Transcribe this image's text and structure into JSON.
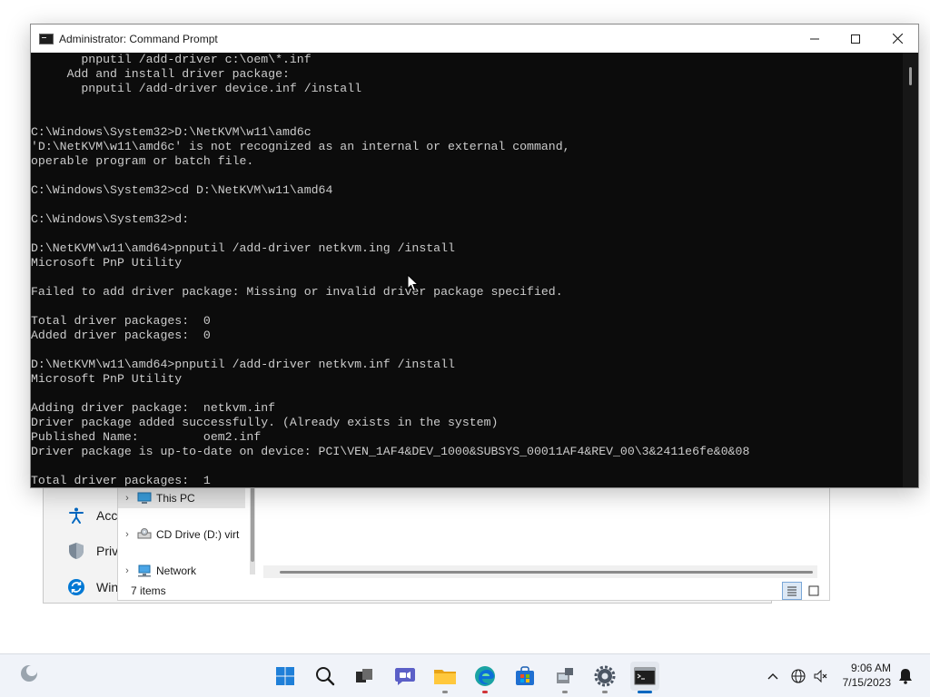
{
  "cmd": {
    "title": "Administrator: Command Prompt",
    "lines": [
      "       pnputil /add-driver c:\\oem\\*.inf",
      "     Add and install driver package:",
      "       pnputil /add-driver device.inf /install",
      "",
      "",
      "C:\\Windows\\System32>D:\\NetKVM\\w11\\amd6c",
      "'D:\\NetKVM\\w11\\amd6c' is not recognized as an internal or external command,",
      "operable program or batch file.",
      "",
      "C:\\Windows\\System32>cd D:\\NetKVM\\w11\\amd64",
      "",
      "C:\\Windows\\System32>d:",
      "",
      "D:\\NetKVM\\w11\\amd64>pnputil /add-driver netkvm.ing /install",
      "Microsoft PnP Utility",
      "",
      "Failed to add driver package: Missing or invalid driver package specified.",
      "",
      "Total driver packages:  0",
      "Added driver packages:  0",
      "",
      "D:\\NetKVM\\w11\\amd64>pnputil /add-driver netkvm.inf /install",
      "Microsoft PnP Utility",
      "",
      "Adding driver package:  netkvm.inf",
      "Driver package added successfully. (Already exists in the system)",
      "Published Name:         oem2.inf",
      "Driver package is up-to-date on device: PCI\\VEN_1AF4&DEV_1000&SUBSYS_00011AF4&REV_00\\3&2411e6fe&0&08",
      "",
      "Total driver packages:  1"
    ]
  },
  "settings": {
    "items": [
      {
        "label": "Acc",
        "icon": "accessibility-icon"
      },
      {
        "label": "Priv",
        "icon": "privacy-shield-icon"
      },
      {
        "label": "Win",
        "icon": "windows-update-icon"
      }
    ]
  },
  "explorer": {
    "nav": [
      {
        "label": "This PC",
        "icon": "this-pc-icon"
      },
      {
        "label": "CD Drive (D:) virt",
        "icon": "cd-drive-icon"
      },
      {
        "label": "Network",
        "icon": "network-icon"
      }
    ],
    "status": "7 items"
  },
  "taskbar": {
    "time": "9:06 AM",
    "date": "7/15/2023",
    "apps": [
      "start-icon",
      "search-icon",
      "task-view-icon",
      "chat-icon",
      "file-explorer-icon",
      "edge-icon",
      "store-icon",
      "device-manager-icon",
      "settings-icon",
      "command-prompt-icon"
    ]
  },
  "colors": {
    "accent": "#0067c0",
    "console_bg": "#0c0c0c",
    "console_text": "#cccccc"
  }
}
